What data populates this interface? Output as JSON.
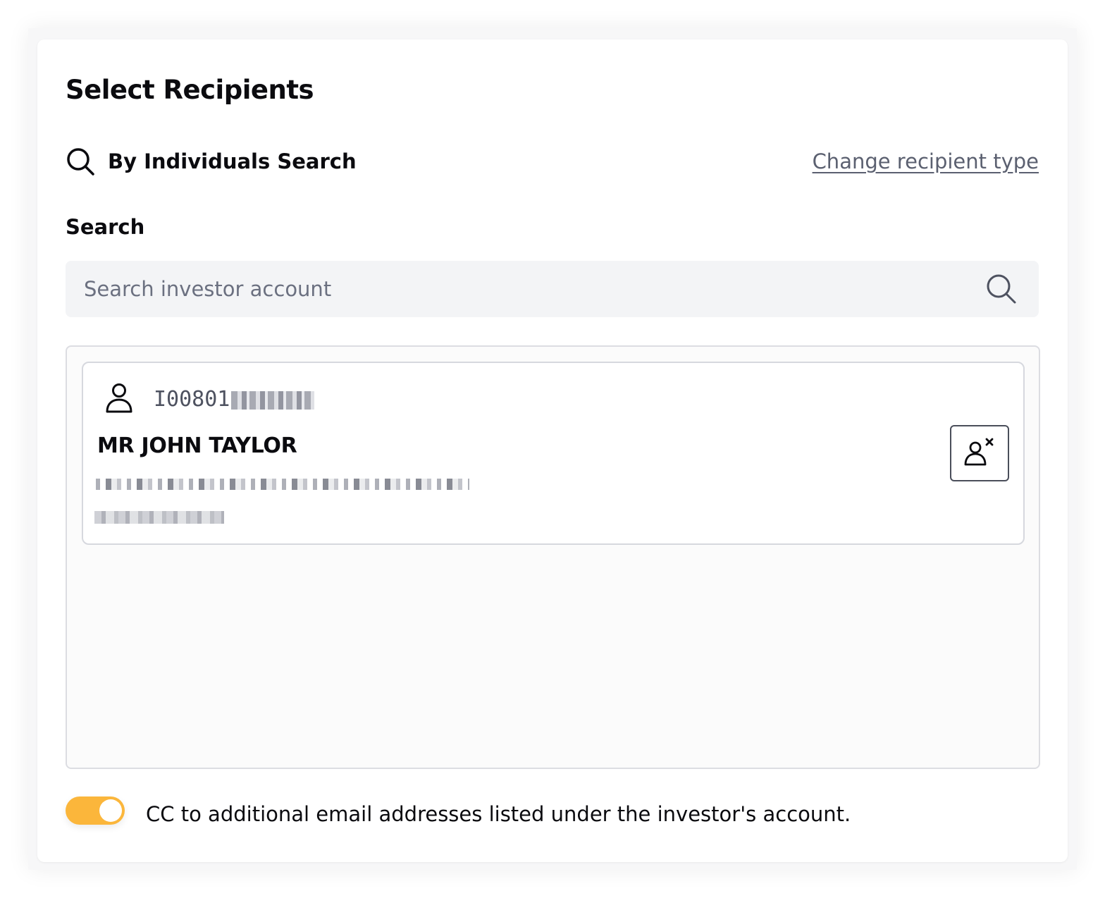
{
  "header": {
    "title": "Select Recipients"
  },
  "mode": {
    "label": "By Individuals Search",
    "icon": "search-icon",
    "change_link": "Change recipient type"
  },
  "search": {
    "label": "Search",
    "placeholder": "Search investor account",
    "value": "",
    "icon": "search-icon"
  },
  "recipients": [
    {
      "icon": "person-icon",
      "account_id_visible": "I00801",
      "name": "MR JOHN TAYLOR",
      "remove_icon": "remove-user-icon"
    }
  ],
  "cc": {
    "enabled": true,
    "label": "CC to additional email addresses listed under the investor's account."
  },
  "colors": {
    "toggle_on": "#fbb63b",
    "link": "#5b6070",
    "text": "#0b0b0f"
  }
}
